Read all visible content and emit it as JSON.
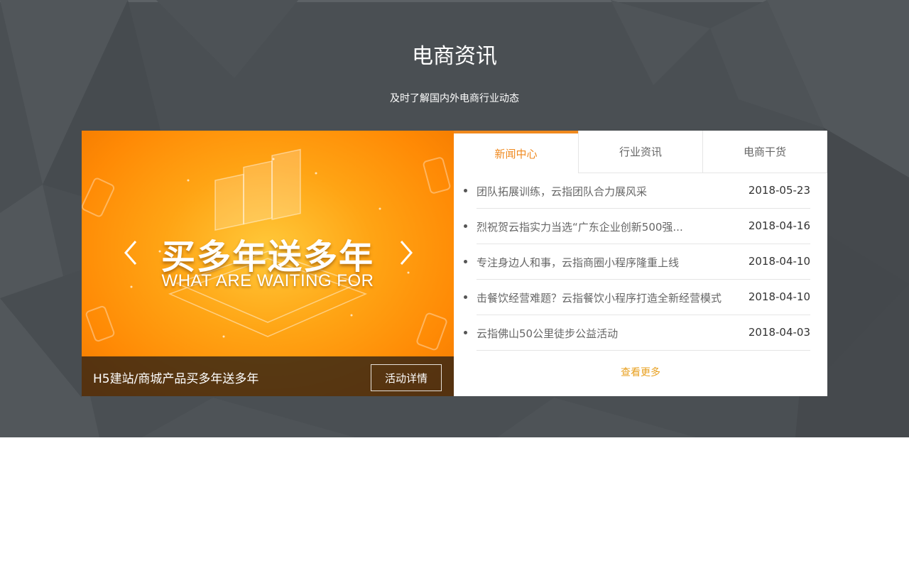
{
  "section": {
    "title": "电商资讯",
    "subtitle": "及时了解国内外电商行业动态"
  },
  "banner": {
    "headline": "买多年送多年",
    "sub": "WHAT ARE WAITING FOR",
    "caption": "H5建站/商城产品买多年送多年",
    "detail_label": "活动详情",
    "prev_icon": "chevron-left-icon",
    "next_icon": "chevron-right-icon"
  },
  "tabs": [
    {
      "label": "新闻中心",
      "active": true
    },
    {
      "label": "行业资讯",
      "active": false
    },
    {
      "label": "电商干货",
      "active": false
    }
  ],
  "news": [
    {
      "title": "团队拓展训练，云指团队合力展风采",
      "date": "2018-05-23"
    },
    {
      "title": "烈祝贺云指实力当选“广东企业创新500强...",
      "date": "2018-04-16"
    },
    {
      "title": "专注身边人和事，云指商圈小程序隆重上线",
      "date": "2018-04-10"
    },
    {
      "title": "击餐饮经营难题？云指餐饮小程序打造全新经营模式",
      "date": "2018-04-10"
    },
    {
      "title": "云指佛山50公里徒步公益活动",
      "date": "2018-04-03"
    }
  ],
  "more_label": "查看更多",
  "colors": {
    "section_bg": "#4a4f53",
    "accent": "#f0891e",
    "more_link": "#e8a020"
  }
}
